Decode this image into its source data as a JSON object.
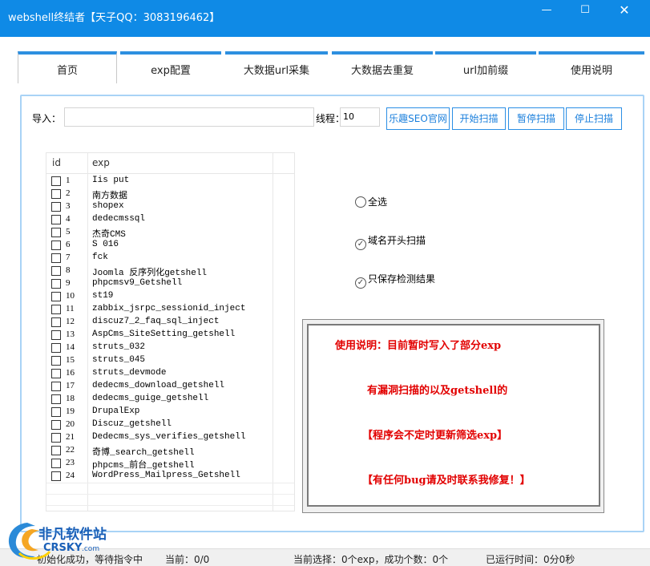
{
  "window": {
    "title": "webshell终结者【天子QQ：3083196462】",
    "min_glyph": "—",
    "max_glyph": "☐",
    "close_glyph": "✕"
  },
  "tabs": [
    "首页",
    "exp配置",
    "大数据url采集",
    "大数据去重复",
    "url加前缀",
    "使用说明"
  ],
  "toolbar": {
    "import_label": "导入：",
    "import_value": "",
    "threads_label": "线程：",
    "threads_value": "10",
    "buttons": [
      "乐趣SEO官网",
      "开始扫描",
      "暂停扫描",
      "停止扫描"
    ]
  },
  "grid": {
    "headers": [
      "id",
      "exp"
    ],
    "rows": [
      {
        "id": "1",
        "exp": "Iis put"
      },
      {
        "id": "2",
        "exp": "南方数据"
      },
      {
        "id": "3",
        "exp": "shopex"
      },
      {
        "id": "4",
        "exp": "dedecmssql"
      },
      {
        "id": "5",
        "exp": "杰奇CMS"
      },
      {
        "id": "6",
        "exp": "S 016"
      },
      {
        "id": "7",
        "exp": "fck"
      },
      {
        "id": "8",
        "exp": "Joomla 反序列化getshell"
      },
      {
        "id": "9",
        "exp": "phpcmsv9_Getshell"
      },
      {
        "id": "10",
        "exp": "st19"
      },
      {
        "id": "11",
        "exp": "zabbix_jsrpc_sessionid_inject"
      },
      {
        "id": "12",
        "exp": "discuz7_2_faq_sql_inject"
      },
      {
        "id": "13",
        "exp": "AspCms_SiteSetting_getshell"
      },
      {
        "id": "14",
        "exp": "struts_032"
      },
      {
        "id": "15",
        "exp": "struts_045"
      },
      {
        "id": "16",
        "exp": "struts_devmode"
      },
      {
        "id": "17",
        "exp": "dedecms_download_getshell"
      },
      {
        "id": "18",
        "exp": "dedecms_guige_getshell"
      },
      {
        "id": "19",
        "exp": "DrupalExp"
      },
      {
        "id": "20",
        "exp": "Discuz_getshell"
      },
      {
        "id": "21",
        "exp": "Dedecms_sys_verifies_getshell"
      },
      {
        "id": "22",
        "exp": "奇博_search_getshell"
      },
      {
        "id": "23",
        "exp": "phpcms_前台_getshell"
      },
      {
        "id": "24",
        "exp": "WordPress_Mailpress_Getshell"
      }
    ]
  },
  "options": [
    {
      "label": "全选",
      "checked": false
    },
    {
      "label": "域名开头扫描",
      "checked": true
    },
    {
      "label": "只保存检测结果",
      "checked": true
    }
  ],
  "notice": [
    "使用说明：目前暂时写入了部分exp",
    "有漏洞扫描的以及getshell的",
    "【程序会不定时更新筛选exp】",
    "【有任何bug请及时联系我修复！】"
  ],
  "status": {
    "init": "初始化成功，等待指令中",
    "current": "当前：0/0",
    "selection": "当前选择：0个exp，成功个数：0个",
    "elapsed": "已运行时间：0分0秒"
  },
  "watermark": {
    "cn": "非凡软件站",
    "en": "CRSKY",
    "domain": ".com"
  },
  "colors": {
    "titlebar": "#0f8ae6",
    "accent": "#2d8fe0",
    "notice_text": "#e20000"
  }
}
